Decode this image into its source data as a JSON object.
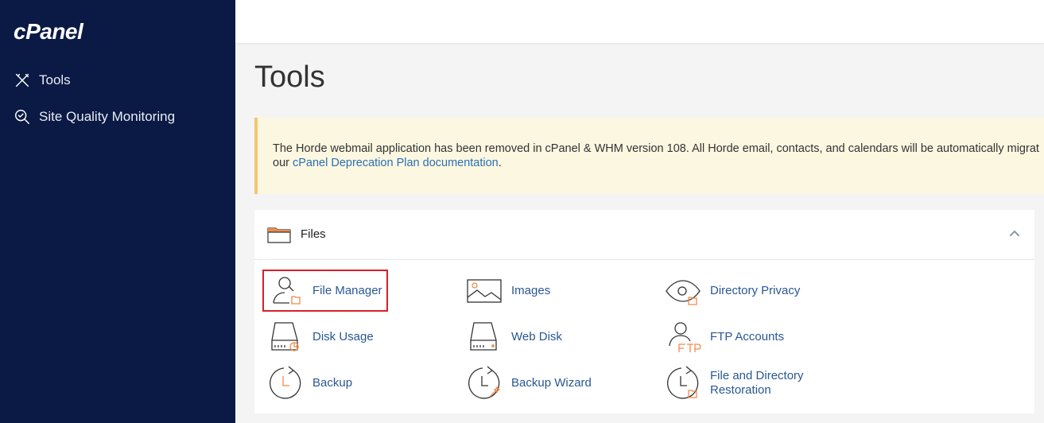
{
  "sidebar": {
    "logo": "cPanel",
    "items": [
      {
        "label": "Tools",
        "icon": "tools-icon"
      },
      {
        "label": "Site Quality Monitoring",
        "icon": "site-quality-icon"
      }
    ]
  },
  "main": {
    "title": "Tools",
    "notice": {
      "text_before": "The Horde webmail application has been removed in cPanel & WHM version 108. All Horde email, contacts, and calendars will be automatically migrat",
      "text_line2_prefix": "our ",
      "link_text": "cPanel Deprecation Plan documentation",
      "text_after": "."
    },
    "files_panel": {
      "title": "Files",
      "tools": [
        {
          "label": "File Manager",
          "icon": "file-manager-icon"
        },
        {
          "label": "Images",
          "icon": "images-icon"
        },
        {
          "label": "Directory Privacy",
          "icon": "directory-privacy-icon"
        },
        {
          "label": "Disk Usage",
          "icon": "disk-usage-icon"
        },
        {
          "label": "Web Disk",
          "icon": "web-disk-icon"
        },
        {
          "label": "FTP Accounts",
          "icon": "ftp-accounts-icon"
        },
        {
          "label": "Backup",
          "icon": "backup-icon"
        },
        {
          "label": "Backup Wizard",
          "icon": "backup-wizard-icon"
        },
        {
          "label_line1": "File and Directory",
          "label_line2": "Restoration",
          "icon": "file-directory-restoration-icon"
        }
      ]
    }
  },
  "colors": {
    "sidebar_bg": "#0b1a44",
    "link": "#2a5794",
    "accent_orange": "#f08a4b",
    "notice_bg": "#fcf7e1",
    "notice_border": "#f2c66d",
    "highlight": "#d52128"
  }
}
